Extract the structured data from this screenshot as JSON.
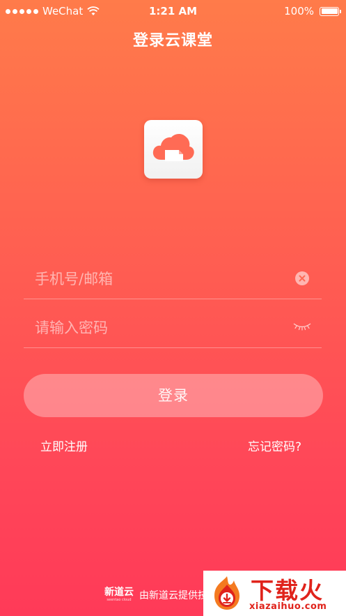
{
  "status_bar": {
    "carrier": "WeChat",
    "time": "1:21 AM",
    "battery": "100%"
  },
  "header": {
    "title": "登录云课堂"
  },
  "form": {
    "phone_placeholder": "手机号/邮箱",
    "phone_value": "",
    "password_placeholder": "请输入密码",
    "password_value": "",
    "login_label": "登录",
    "register_label": "立即注册",
    "forgot_label": "忘记密码?"
  },
  "footer": {
    "brand": "新道云",
    "brand_en": "seentao cloud",
    "provider_text": "由新道云提供技"
  },
  "watermark": {
    "title": "下载火",
    "url": "xiazaihuo.com"
  },
  "colors": {
    "gradient_top": "#FF7B4A",
    "gradient_bottom": "#FF3A58",
    "logo_cloud": "#FF6B55",
    "watermark_red": "#E0231B"
  },
  "icons": {
    "wifi": "wifi-icon",
    "battery": "battery-icon",
    "app_logo": "cloud-logo-icon",
    "clear": "clear-icon",
    "password_toggle": "eye-closed-icon",
    "watermark_logo": "flame-download-icon"
  }
}
